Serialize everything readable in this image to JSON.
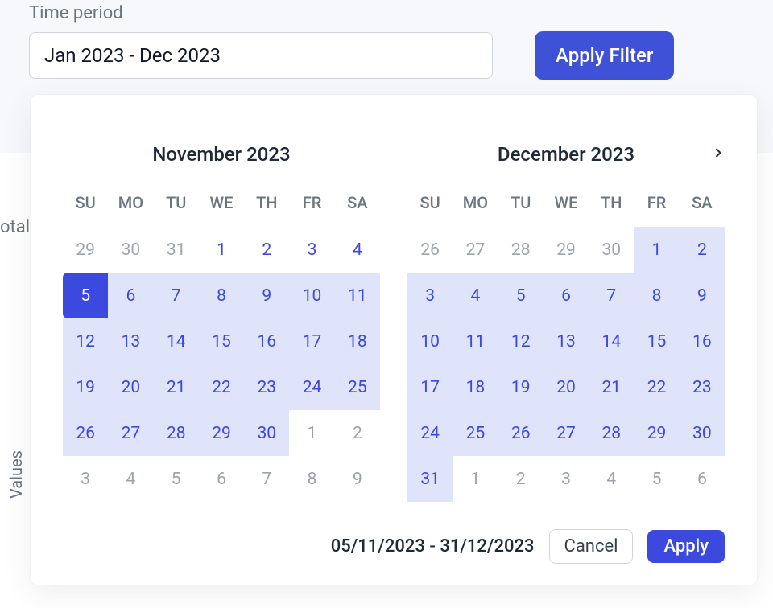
{
  "filter": {
    "label": "Time period",
    "input_value": "Jan 2023 - Dec 2023",
    "apply_label": "Apply Filter"
  },
  "background": {
    "truncated_text": "otal",
    "yaxis": "Values"
  },
  "picker": {
    "weekdays": [
      "SU",
      "MO",
      "TU",
      "WE",
      "TH",
      "FR",
      "SA"
    ],
    "range_text": "05/11/2023 - 31/12/2023",
    "cancel": "Cancel",
    "apply": "Apply",
    "months": [
      {
        "title": "November 2023",
        "days": [
          {
            "n": 29,
            "cls": "outside"
          },
          {
            "n": 30,
            "cls": "outside"
          },
          {
            "n": 31,
            "cls": "outside"
          },
          {
            "n": 1,
            "cls": "in-month"
          },
          {
            "n": 2,
            "cls": "in-month"
          },
          {
            "n": 3,
            "cls": "in-month"
          },
          {
            "n": 4,
            "cls": "in-month"
          },
          {
            "n": 5,
            "cls": "selected-start"
          },
          {
            "n": 6,
            "cls": "in-range"
          },
          {
            "n": 7,
            "cls": "in-range"
          },
          {
            "n": 8,
            "cls": "in-range"
          },
          {
            "n": 9,
            "cls": "in-range"
          },
          {
            "n": 10,
            "cls": "in-range"
          },
          {
            "n": 11,
            "cls": "in-range"
          },
          {
            "n": 12,
            "cls": "in-range"
          },
          {
            "n": 13,
            "cls": "in-range"
          },
          {
            "n": 14,
            "cls": "in-range"
          },
          {
            "n": 15,
            "cls": "in-range"
          },
          {
            "n": 16,
            "cls": "in-range"
          },
          {
            "n": 17,
            "cls": "in-range"
          },
          {
            "n": 18,
            "cls": "in-range"
          },
          {
            "n": 19,
            "cls": "in-range"
          },
          {
            "n": 20,
            "cls": "in-range"
          },
          {
            "n": 21,
            "cls": "in-range"
          },
          {
            "n": 22,
            "cls": "in-range"
          },
          {
            "n": 23,
            "cls": "in-range"
          },
          {
            "n": 24,
            "cls": "in-range"
          },
          {
            "n": 25,
            "cls": "in-range"
          },
          {
            "n": 26,
            "cls": "in-range"
          },
          {
            "n": 27,
            "cls": "in-range"
          },
          {
            "n": 28,
            "cls": "in-range"
          },
          {
            "n": 29,
            "cls": "in-range"
          },
          {
            "n": 30,
            "cls": "in-range"
          },
          {
            "n": 1,
            "cls": "outside"
          },
          {
            "n": 2,
            "cls": "outside"
          },
          {
            "n": 3,
            "cls": "outside"
          },
          {
            "n": 4,
            "cls": "outside"
          },
          {
            "n": 5,
            "cls": "outside"
          },
          {
            "n": 6,
            "cls": "outside"
          },
          {
            "n": 7,
            "cls": "outside"
          },
          {
            "n": 8,
            "cls": "outside"
          },
          {
            "n": 9,
            "cls": "outside"
          }
        ]
      },
      {
        "title": "December 2023",
        "days": [
          {
            "n": 26,
            "cls": "outside"
          },
          {
            "n": 27,
            "cls": "outside"
          },
          {
            "n": 28,
            "cls": "outside"
          },
          {
            "n": 29,
            "cls": "outside"
          },
          {
            "n": 30,
            "cls": "outside"
          },
          {
            "n": 1,
            "cls": "in-range"
          },
          {
            "n": 2,
            "cls": "in-range"
          },
          {
            "n": 3,
            "cls": "in-range"
          },
          {
            "n": 4,
            "cls": "in-range"
          },
          {
            "n": 5,
            "cls": "in-range"
          },
          {
            "n": 6,
            "cls": "in-range"
          },
          {
            "n": 7,
            "cls": "in-range"
          },
          {
            "n": 8,
            "cls": "in-range"
          },
          {
            "n": 9,
            "cls": "in-range"
          },
          {
            "n": 10,
            "cls": "in-range"
          },
          {
            "n": 11,
            "cls": "in-range"
          },
          {
            "n": 12,
            "cls": "in-range"
          },
          {
            "n": 13,
            "cls": "in-range"
          },
          {
            "n": 14,
            "cls": "in-range"
          },
          {
            "n": 15,
            "cls": "in-range"
          },
          {
            "n": 16,
            "cls": "in-range"
          },
          {
            "n": 17,
            "cls": "in-range"
          },
          {
            "n": 18,
            "cls": "in-range"
          },
          {
            "n": 19,
            "cls": "in-range"
          },
          {
            "n": 20,
            "cls": "in-range"
          },
          {
            "n": 21,
            "cls": "in-range"
          },
          {
            "n": 22,
            "cls": "in-range"
          },
          {
            "n": 23,
            "cls": "in-range"
          },
          {
            "n": 24,
            "cls": "in-range"
          },
          {
            "n": 25,
            "cls": "in-range"
          },
          {
            "n": 26,
            "cls": "in-range"
          },
          {
            "n": 27,
            "cls": "in-range"
          },
          {
            "n": 28,
            "cls": "in-range"
          },
          {
            "n": 29,
            "cls": "in-range"
          },
          {
            "n": 30,
            "cls": "in-range"
          },
          {
            "n": 31,
            "cls": "selected-end in-range"
          },
          {
            "n": 1,
            "cls": "outside"
          },
          {
            "n": 2,
            "cls": "outside"
          },
          {
            "n": 3,
            "cls": "outside"
          },
          {
            "n": 4,
            "cls": "outside"
          },
          {
            "n": 5,
            "cls": "outside"
          },
          {
            "n": 6,
            "cls": "outside"
          }
        ]
      }
    ]
  }
}
